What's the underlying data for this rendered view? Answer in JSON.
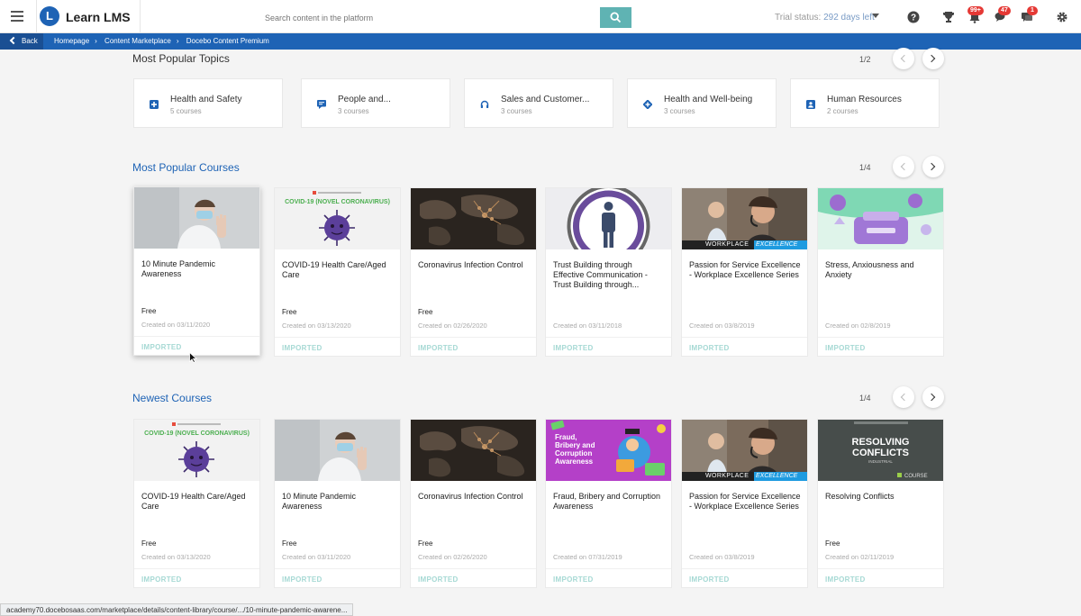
{
  "header": {
    "brand_name": "Learn LMS",
    "brand_logo_letter": "L",
    "search_placeholder": "Search content in the platform",
    "trial_label": "Trial status: ",
    "trial_days": "292 days left",
    "badges": {
      "notifications": "99+",
      "messages": "47",
      "chat": "1"
    }
  },
  "breadcrumb": {
    "back_label": "Back",
    "items": [
      "Homepage",
      "Content Marketplace",
      "Docebo Content Premium"
    ]
  },
  "topics_section": {
    "title": "Most Popular Topics",
    "pager": "1/2",
    "items": [
      {
        "name": "Health and Safety",
        "count": "5 courses",
        "icon": "plus-square-icon"
      },
      {
        "name": "People and...",
        "count": "3 courses",
        "icon": "chat-bubble-icon"
      },
      {
        "name": "Sales and Customer...",
        "count": "3 courses",
        "icon": "headset-icon"
      },
      {
        "name": "Health and Well-being",
        "count": "3 courses",
        "icon": "wellbeing-icon"
      },
      {
        "name": "Human Resources",
        "count": "2 courses",
        "icon": "id-badge-icon"
      }
    ]
  },
  "popular_section": {
    "title": "Most Popular Courses",
    "pager": "1/4",
    "items": [
      {
        "title": "10 Minute Pandemic Awareness",
        "price": "Free",
        "date": "Created on 03/11/2020",
        "tag": "IMPORTED",
        "thumb": "doctor"
      },
      {
        "title": "COVID-19 Health Care/Aged Care",
        "price": "Free",
        "date": "Created on 03/13/2020",
        "tag": "IMPORTED",
        "thumb": "covid"
      },
      {
        "title": "Coronavirus Infection Control",
        "price": "Free",
        "date": "Created on 02/26/2020",
        "tag": "IMPORTED",
        "thumb": "map"
      },
      {
        "title": "Trust Building through Effective Communication - Trust Building through...",
        "price": "",
        "date": "Created on 03/11/2018",
        "tag": "IMPORTED",
        "thumb": "trust"
      },
      {
        "title": "Passion for Service Excellence - Workplace Excellence Series",
        "price": "",
        "date": "Created on 03/8/2019",
        "tag": "IMPORTED",
        "thumb": "workplace"
      },
      {
        "title": "Stress, Anxiousness and Anxiety",
        "price": "",
        "date": "Created on 02/8/2019",
        "tag": "IMPORTED",
        "thumb": "stress"
      }
    ]
  },
  "newest_section": {
    "title": "Newest Courses",
    "pager": "1/4",
    "items": [
      {
        "title": "COVID-19 Health Care/Aged Care",
        "price": "Free",
        "date": "Created on 03/13/2020",
        "tag": "IMPORTED",
        "thumb": "covid"
      },
      {
        "title": "10 Minute Pandemic Awareness",
        "price": "Free",
        "date": "Created on 03/11/2020",
        "tag": "IMPORTED",
        "thumb": "doctor"
      },
      {
        "title": "Coronavirus Infection Control",
        "price": "Free",
        "date": "Created on 02/26/2020",
        "tag": "IMPORTED",
        "thumb": "map"
      },
      {
        "title": "Fraud, Bribery and Corruption Awareness",
        "price": "",
        "date": "Created on 07/31/2019",
        "tag": "IMPORTED",
        "thumb": "fraud"
      },
      {
        "title": "Passion for Service Excellence - Workplace Excellence Series",
        "price": "",
        "date": "Created on 03/8/2019",
        "tag": "IMPORTED",
        "thumb": "workplace"
      },
      {
        "title": "Resolving Conflicts",
        "price": "Free",
        "date": "Created on 02/11/2019",
        "tag": "IMPORTED",
        "thumb": "conflicts"
      }
    ]
  },
  "thumb_text": {
    "covid": "COVID-19 (NOVEL CORONAVIRUS)",
    "fraud_lines": [
      "Fraud,",
      "Bribery and",
      "Corruption",
      "Awareness"
    ],
    "workplace_left": "WORKPLACE",
    "workplace_right": "EXCELLENCE",
    "conflicts_lines": [
      "RESOLVING",
      "CONFLICTS"
    ],
    "conflicts_sub": "INDUSTRIAL",
    "conflicts_course": "COURSE"
  },
  "status_bar_url": "academy70.docebosaas.com/marketplace/details/content-library/course/.../10-minute-pandemic-awarene...",
  "colors": {
    "brand_blue": "#1e63b5",
    "search_button": "#5fb3b3",
    "imported_tag": "#a6d9d4",
    "badge_red": "#e53935"
  }
}
